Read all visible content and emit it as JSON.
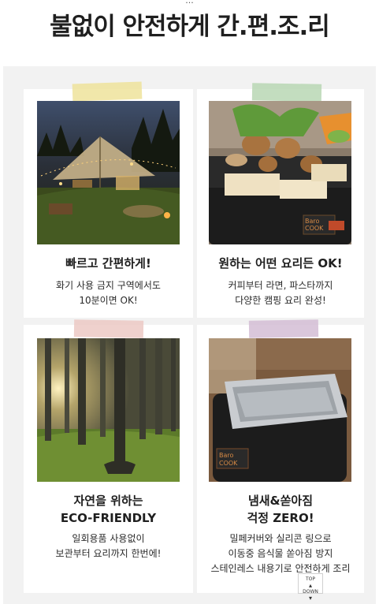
{
  "header": {
    "top_cut_text": "...",
    "headline": "불없이 안전하게 간.편.조.리"
  },
  "cards": [
    {
      "title_lines": [
        "빠르고 간편하게!"
      ],
      "desc_lines": [
        "화기 사용 금지 구역에서도",
        "10분이면 OK!"
      ]
    },
    {
      "title_lines": [
        "원하는 어떤 요리든 OK!"
      ],
      "desc_lines": [
        "커피부터 라면, 파스타까지",
        "다양한 캠핑 요리 완성!"
      ]
    },
    {
      "title_lines": [
        "자연을 위하는",
        "ECO-FRIENDLY"
      ],
      "desc_lines": [
        "일회용품 사용없이",
        "보관부터 요리까지 한번에!"
      ]
    },
    {
      "title_lines": [
        "냄새&쏟아짐",
        "걱정 ZERO!"
      ],
      "desc_lines": [
        "밀페커버와 실리콘 링으로",
        "이동중 음식물 쏟아짐 방지",
        "스테인레스 내용기로 안전하게 조리"
      ]
    }
  ],
  "product_label": {
    "brand_top": "Baro",
    "brand_bottom": "COOK"
  },
  "scroll_button": {
    "top": "TOP",
    "down": "DOWN"
  },
  "colors": {
    "tape_yellow": "#efe39b",
    "tape_green": "#b8d7b4",
    "tape_pink": "#ecc9c4",
    "tape_purple": "#d3bdd5",
    "panel": "#f2f2f2"
  }
}
